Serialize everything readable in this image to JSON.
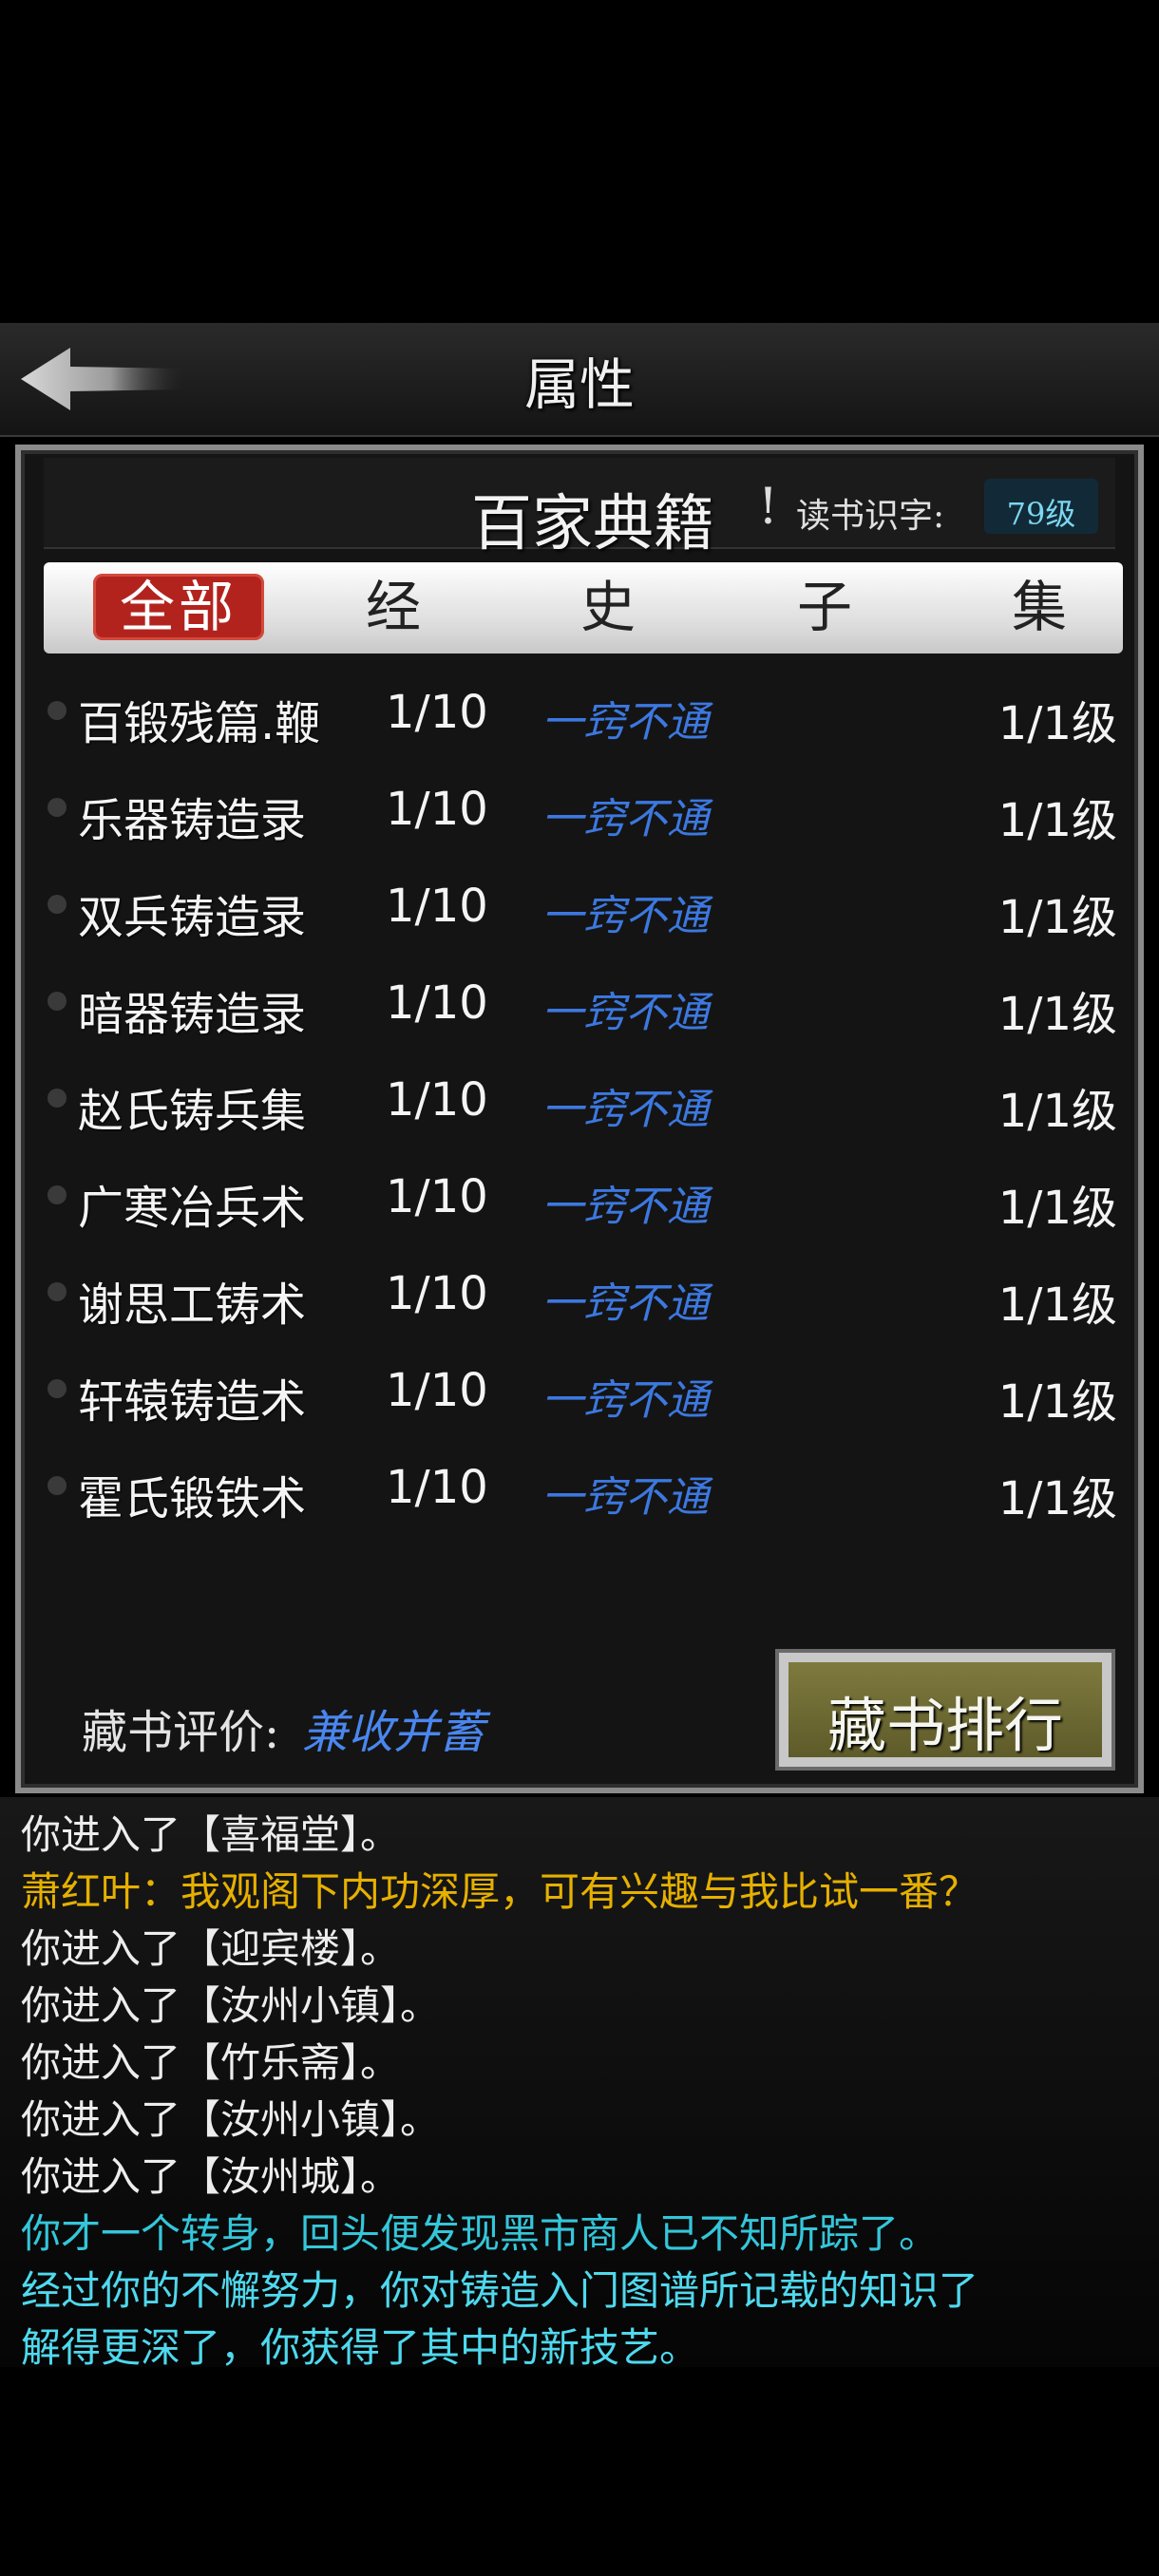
{
  "topbar": {
    "title": "属性"
  },
  "panel": {
    "header_title": "百家典籍",
    "header_mark": "!",
    "read_label": "读书识字:",
    "read_value": "79级",
    "tabs": [
      "全部",
      "经",
      "史",
      "子",
      "集"
    ],
    "active_tab": 0,
    "books": [
      {
        "name": "百锻残篇.鞭",
        "progress": "1/10",
        "rank": "一窍不通",
        "level": "1/1级"
      },
      {
        "name": "乐器铸造录",
        "progress": "1/10",
        "rank": "一窍不通",
        "level": "1/1级"
      },
      {
        "name": "双兵铸造录",
        "progress": "1/10",
        "rank": "一窍不通",
        "level": "1/1级"
      },
      {
        "name": "暗器铸造录",
        "progress": "1/10",
        "rank": "一窍不通",
        "level": "1/1级"
      },
      {
        "name": "赵氏铸兵集",
        "progress": "1/10",
        "rank": "一窍不通",
        "level": "1/1级"
      },
      {
        "name": "广寒冶兵术",
        "progress": "1/10",
        "rank": "一窍不通",
        "level": "1/1级"
      },
      {
        "name": "谢思工铸术",
        "progress": "1/10",
        "rank": "一窍不通",
        "level": "1/1级"
      },
      {
        "name": "轩辕铸造术",
        "progress": "1/10",
        "rank": "一窍不通",
        "level": "1/1级"
      },
      {
        "name": "霍氏锻铁术",
        "progress": "1/10",
        "rank": "一窍不通",
        "level": "1/1级"
      }
    ],
    "evaluation_label": "藏书评价:",
    "evaluation_value": "兼收并蓄",
    "ranking_button": "藏书排行"
  },
  "log": [
    {
      "text": "你进入了【喜福堂】。",
      "color": "#ededed"
    },
    {
      "text": "萧红叶：我观阁下内功深厚，可有兴趣与我比试一番？",
      "color": "#e6b000"
    },
    {
      "text": "你进入了【迎宾楼】。",
      "color": "#ededed"
    },
    {
      "text": "你进入了【汝州小镇】。",
      "color": "#ededed"
    },
    {
      "text": "你进入了【竹乐斋】。",
      "color": "#ededed"
    },
    {
      "text": "你进入了【汝州小镇】。",
      "color": "#ededed"
    },
    {
      "text": "你进入了【汝州城】。",
      "color": "#ededed"
    },
    {
      "text": "你才一个转身，回头便发现黑市商人已不知所踪了。",
      "color": "#34c6da"
    },
    {
      "text": "经过你的不懈努力，你对铸造入门图谱所记载的知识了",
      "color": "#4fd9ee"
    },
    {
      "text": "解得更深了，你获得了其中的新技艺。",
      "color": "#4fd9ee"
    }
  ],
  "colors": {
    "accent_red": "#b3231e",
    "rank_blue": "#3c78e0",
    "button_olive": "#6e6a34"
  }
}
